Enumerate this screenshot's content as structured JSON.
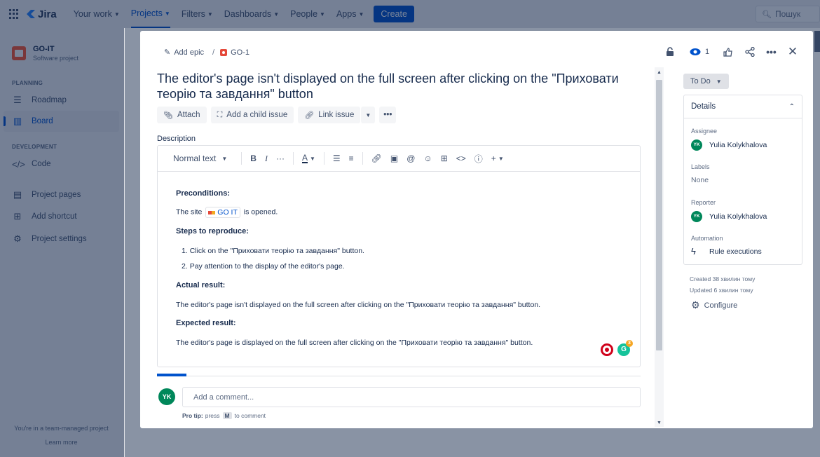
{
  "topnav": {
    "logo": "Jira",
    "items": [
      {
        "label": "Your work"
      },
      {
        "label": "Projects"
      },
      {
        "label": "Filters"
      },
      {
        "label": "Dashboards"
      },
      {
        "label": "People"
      },
      {
        "label": "Apps"
      }
    ],
    "create": "Create",
    "search_placeholder": "Пошук"
  },
  "sidebar": {
    "project_name": "GO-IT",
    "project_type": "Software project",
    "planning_head": "PLANNING",
    "roadmap": "Roadmap",
    "board": "Board",
    "development_head": "DEVELOPMENT",
    "code": "Code",
    "project_pages": "Project pages",
    "add_shortcut": "Add shortcut",
    "project_settings": "Project settings",
    "footer_text": "You're in a team-managed project",
    "learn_more": "Learn more"
  },
  "issue": {
    "add_epic": "Add epic",
    "key": "GO-1",
    "watch_count": "1",
    "title": "The editor's page isn't displayed on the full screen after clicking on the \"Приховати теорію та завдання\" button",
    "actions": {
      "attach": "Attach",
      "add_child": "Add a child issue",
      "link_issue": "Link issue"
    },
    "description_label": "Description",
    "editor": {
      "text_style": "Normal text",
      "preconditions_h": "Preconditions:",
      "site_pre": "The site",
      "site_link": "GO IT",
      "site_post": "is opened.",
      "steps_h": "Steps to reproduce:",
      "step1": "Click on the \"Приховати теорію та завдання\" button.",
      "step2": "Pay attention to the display of the editor's page.",
      "actual_h": "Actual result:",
      "actual": "The editor's page isn't displayed on the full screen after clicking on the \"Приховати теорію та завдання\" button.",
      "expected_h": "Expected result:",
      "expected": "The editor's page is displayed on the full screen after clicking on the \"Приховати теорію та завдання\" button.",
      "grammarly_count": "3"
    },
    "comment": {
      "avatar": "YK",
      "placeholder": "Add a comment...",
      "protip_label": "Pro tip:",
      "protip_press": "press",
      "protip_key": "M",
      "protip_rest": "to comment"
    }
  },
  "panel": {
    "status": "To Do",
    "details_head": "Details",
    "assignee_label": "Assignee",
    "assignee_initials": "YK",
    "assignee": "Yulia Kolykhalova",
    "labels_label": "Labels",
    "labels_value": "None",
    "reporter_label": "Reporter",
    "reporter_initials": "YK",
    "reporter": "Yulia Kolykhalova",
    "automation_label": "Automation",
    "automation_value": "Rule executions",
    "created": "Created 38 хвилин тому",
    "updated": "Updated 6 хвилин тому",
    "configure": "Configure"
  },
  "colors": {
    "brand": "#0052cc",
    "avatar": "#00875a",
    "bug": "#e5493a"
  }
}
